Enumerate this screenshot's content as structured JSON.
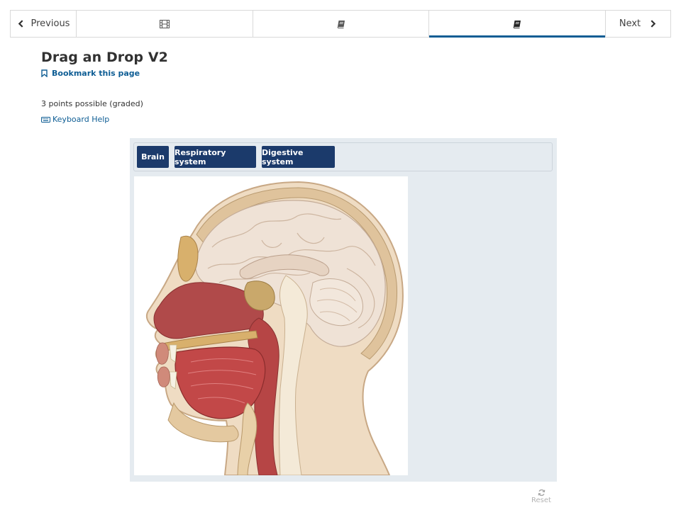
{
  "nav": {
    "previous_label": "Previous",
    "next_label": "Next",
    "tabs": [
      {
        "icon": "film-icon",
        "active": false
      },
      {
        "icon": "book-icon",
        "active": false
      },
      {
        "icon": "book-icon",
        "active": true
      }
    ]
  },
  "unit": {
    "title": "Drag an Drop V2",
    "bookmark_label": "Bookmark this page",
    "points": "3 points possible (graded)",
    "keyboard_help": "Keyboard Help"
  },
  "dnd": {
    "items": [
      {
        "label": "Brain"
      },
      {
        "label": "Respiratory system"
      },
      {
        "label": "Digestive system"
      }
    ],
    "target_image": "head-sagittal-anatomy-illustration"
  },
  "reset_label": "Reset",
  "colors": {
    "accent": "#0e5d94",
    "item_bg": "#1b3a6b",
    "zone_bg": "#e5ebf0"
  }
}
